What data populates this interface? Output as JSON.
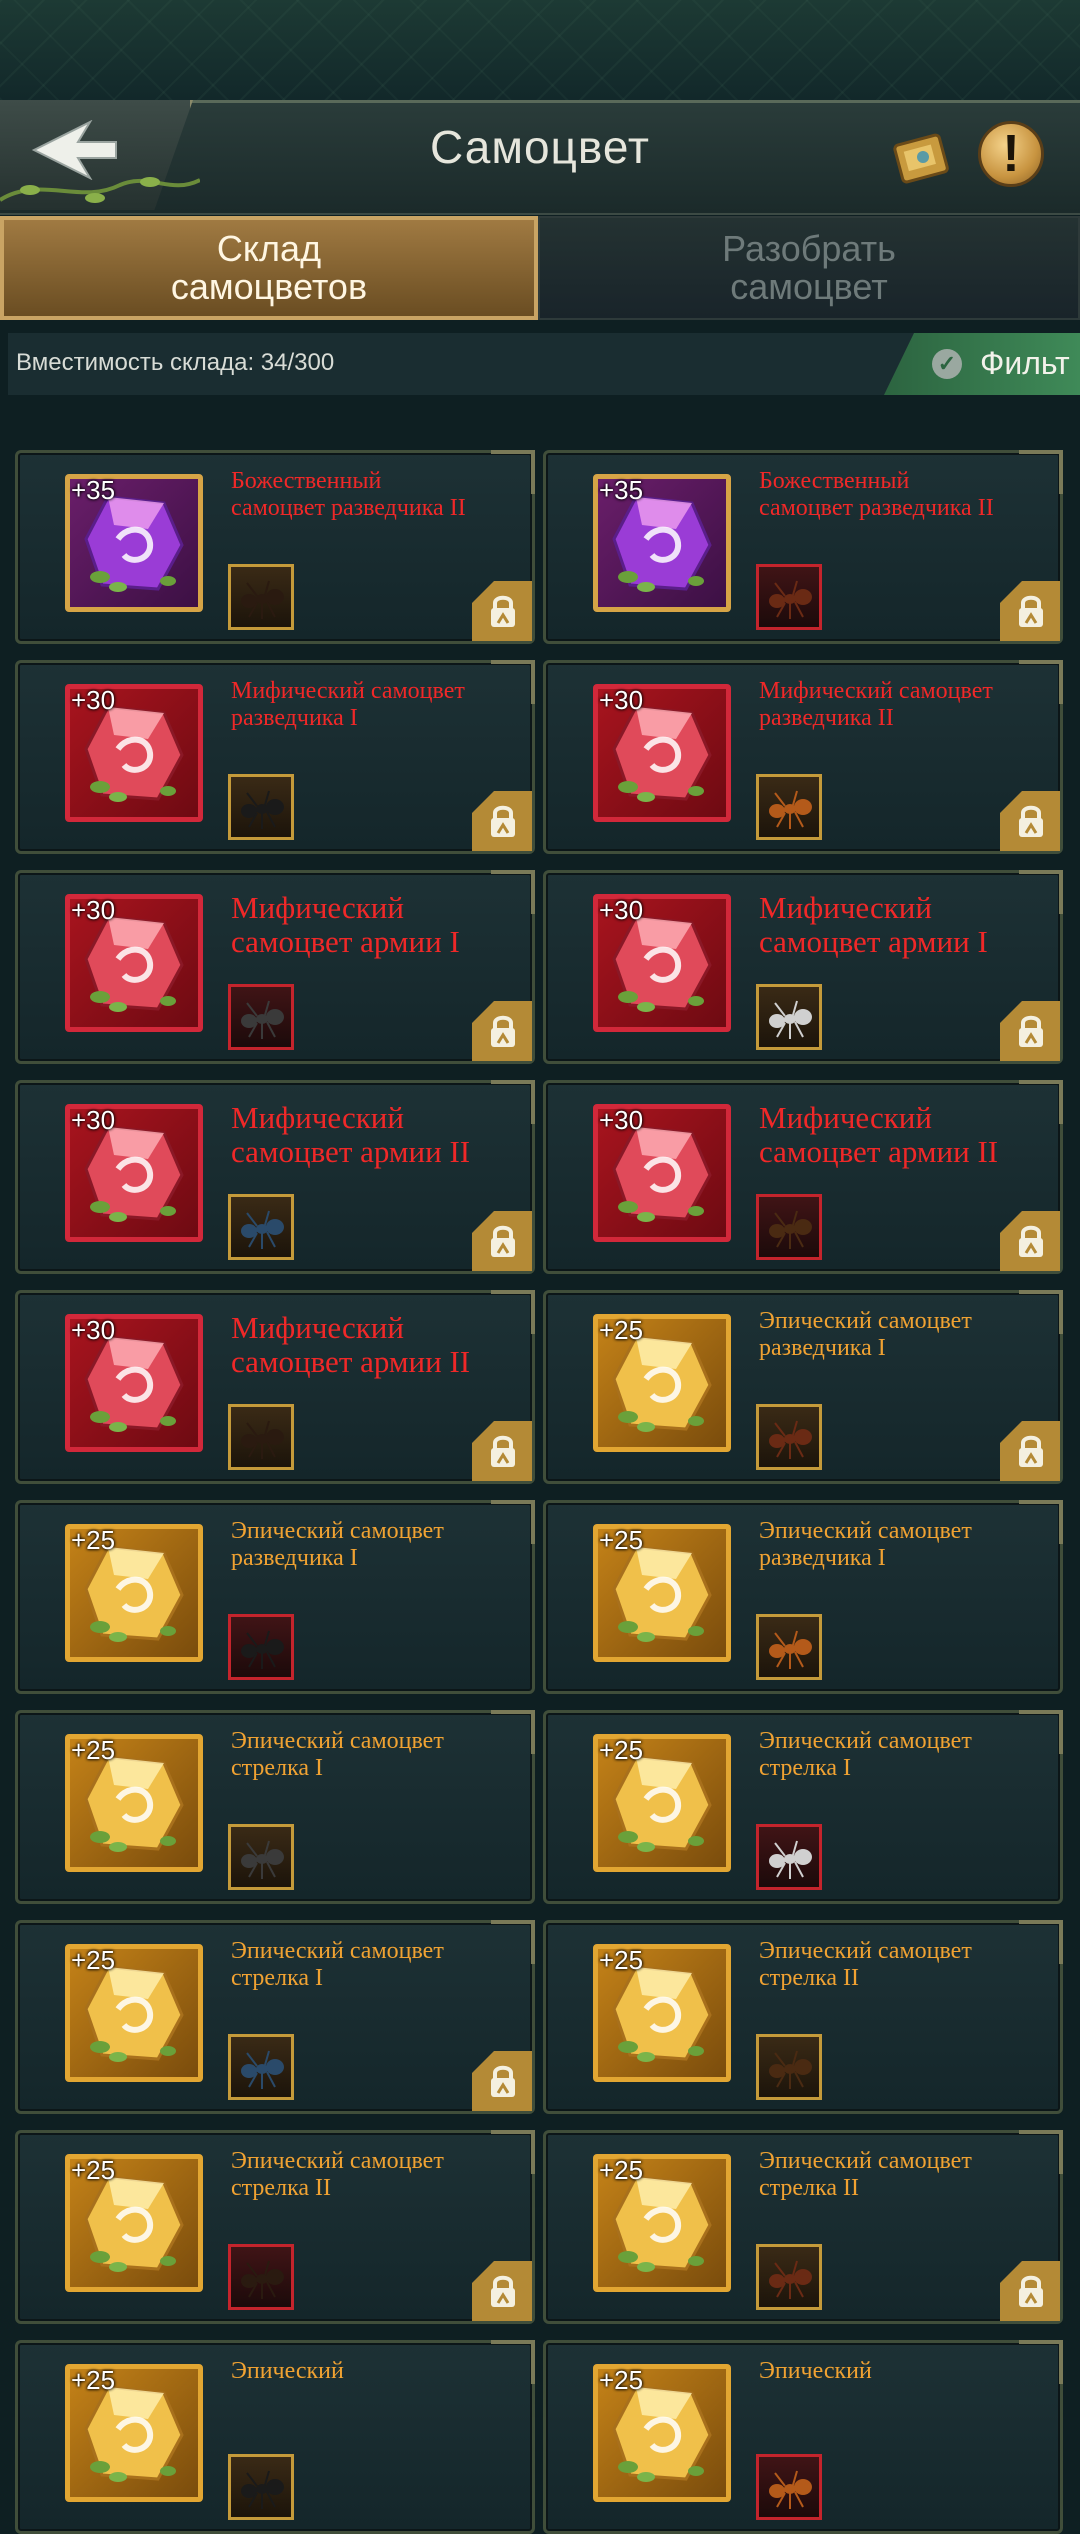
{
  "header": {
    "title": "Самоцвет"
  },
  "tabs": [
    {
      "label": "Склад\nсамоцветов",
      "active": true
    },
    {
      "label": "Разобрать\nсамоцвет",
      "active": false
    }
  ],
  "capacity": {
    "text": "Вместимость склада: 34/300"
  },
  "filter": {
    "label": "Фильт"
  },
  "colors": {
    "mythic_red": "#f02828",
    "epic_orange": "#f0a232",
    "tab_active": "#a07a42",
    "filter_green": "#3f8a58"
  },
  "gems": [
    {
      "level": "+35",
      "name": "Божественный\nсамоцвет разведчика II",
      "rarity": "divine",
      "locked": true
    },
    {
      "level": "+35",
      "name": "Божественный\nсамоцвет разведчика II",
      "rarity": "divine",
      "locked": true
    },
    {
      "level": "+30",
      "name": "Мифический самоцвет\nразведчика I",
      "rarity": "mythic",
      "locked": true
    },
    {
      "level": "+30",
      "name": "Мифический самоцвет\nразведчика II",
      "rarity": "mythic",
      "locked": true
    },
    {
      "level": "+30",
      "name": "Мифический\nсамоцвет армии I",
      "rarity": "mythic",
      "locked": true
    },
    {
      "level": "+30",
      "name": "Мифический\nсамоцвет армии I",
      "rarity": "mythic",
      "locked": true
    },
    {
      "level": "+30",
      "name": "Мифический\nсамоцвет армии II",
      "rarity": "mythic",
      "locked": true
    },
    {
      "level": "+30",
      "name": "Мифический\nсамоцвет армии II",
      "rarity": "mythic",
      "locked": true
    },
    {
      "level": "+30",
      "name": "Мифический\nсамоцвет армии II",
      "rarity": "mythic",
      "locked": true
    },
    {
      "level": "+25",
      "name": "Эпический самоцвет\nразведчика I",
      "rarity": "epic",
      "locked": true
    },
    {
      "level": "+25",
      "name": "Эпический самоцвет\nразведчика I",
      "rarity": "epic",
      "locked": false
    },
    {
      "level": "+25",
      "name": "Эпический самоцвет\nразведчика I",
      "rarity": "epic",
      "locked": false
    },
    {
      "level": "+25",
      "name": "Эпический самоцвет\nстрелка I",
      "rarity": "epic",
      "locked": false
    },
    {
      "level": "+25",
      "name": "Эпический самоцвет\nстрелка I",
      "rarity": "epic",
      "locked": false
    },
    {
      "level": "+25",
      "name": "Эпический самоцвет\nстрелка I",
      "rarity": "epic",
      "locked": true
    },
    {
      "level": "+25",
      "name": "Эпический самоцвет\nстрелка II",
      "rarity": "epic",
      "locked": false
    },
    {
      "level": "+25",
      "name": "Эпический самоцвет\nстрелка II",
      "rarity": "epic",
      "locked": true
    },
    {
      "level": "+25",
      "name": "Эпический самоцвет\nстрелка II",
      "rarity": "epic",
      "locked": true
    },
    {
      "level": "+25",
      "name": "Эпический",
      "rarity": "epic",
      "locked": false
    },
    {
      "level": "+25",
      "name": "Эпический",
      "rarity": "epic",
      "locked": false
    }
  ]
}
